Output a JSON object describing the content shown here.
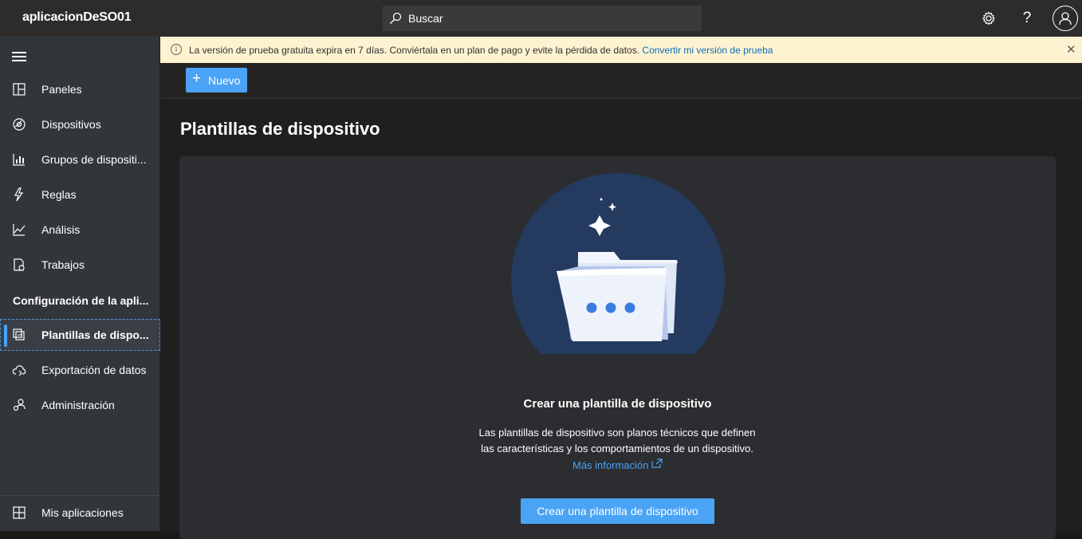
{
  "header": {
    "app_title": "aplicacionDeSO01",
    "search_placeholder": "Buscar",
    "help_label": "?"
  },
  "banner": {
    "message": "La versión de prueba gratuita expira en 7 días. Conviértala en un plan de pago y evite la pérdida de datos.",
    "link_label": "Convertir mi versión de prueba",
    "close_label": "✕"
  },
  "sidebar": {
    "items": [
      {
        "label": "Paneles",
        "icon": "dashboard-icon"
      },
      {
        "label": "Dispositivos",
        "icon": "devices-icon"
      },
      {
        "label": "Grupos de dispositi...",
        "icon": "device-groups-icon"
      },
      {
        "label": "Reglas",
        "icon": "rules-icon"
      },
      {
        "label": "Análisis",
        "icon": "analytics-icon"
      },
      {
        "label": "Trabajos",
        "icon": "jobs-icon"
      }
    ],
    "section_title": "Configuración de la apli...",
    "config_items": [
      {
        "label": "Plantillas de dispo...",
        "icon": "device-templates-icon",
        "active": true
      },
      {
        "label": "Exportación de datos",
        "icon": "data-export-icon"
      },
      {
        "label": "Administración",
        "icon": "administration-icon"
      }
    ],
    "footer_item": {
      "label": "Mis aplicaciones",
      "icon": "my-apps-icon"
    }
  },
  "toolbar": {
    "new_label": "Nuevo"
  },
  "main": {
    "page_title": "Plantillas de dispositivo",
    "empty_state": {
      "title": "Crear una plantilla de dispositivo",
      "description_line1": "Las plantillas de dispositivo son planos técnicos que definen",
      "description_line2": "las características y los comportamientos de un dispositivo.",
      "link_label": "Más información",
      "button_label": "Crear una plantilla de dispositivo"
    }
  },
  "colors": {
    "accent": "#4aa3f5",
    "banner_bg": "#fdf3d0",
    "topbar_bg": "#2d2c2b",
    "sidebar_bg": "#32363b"
  }
}
